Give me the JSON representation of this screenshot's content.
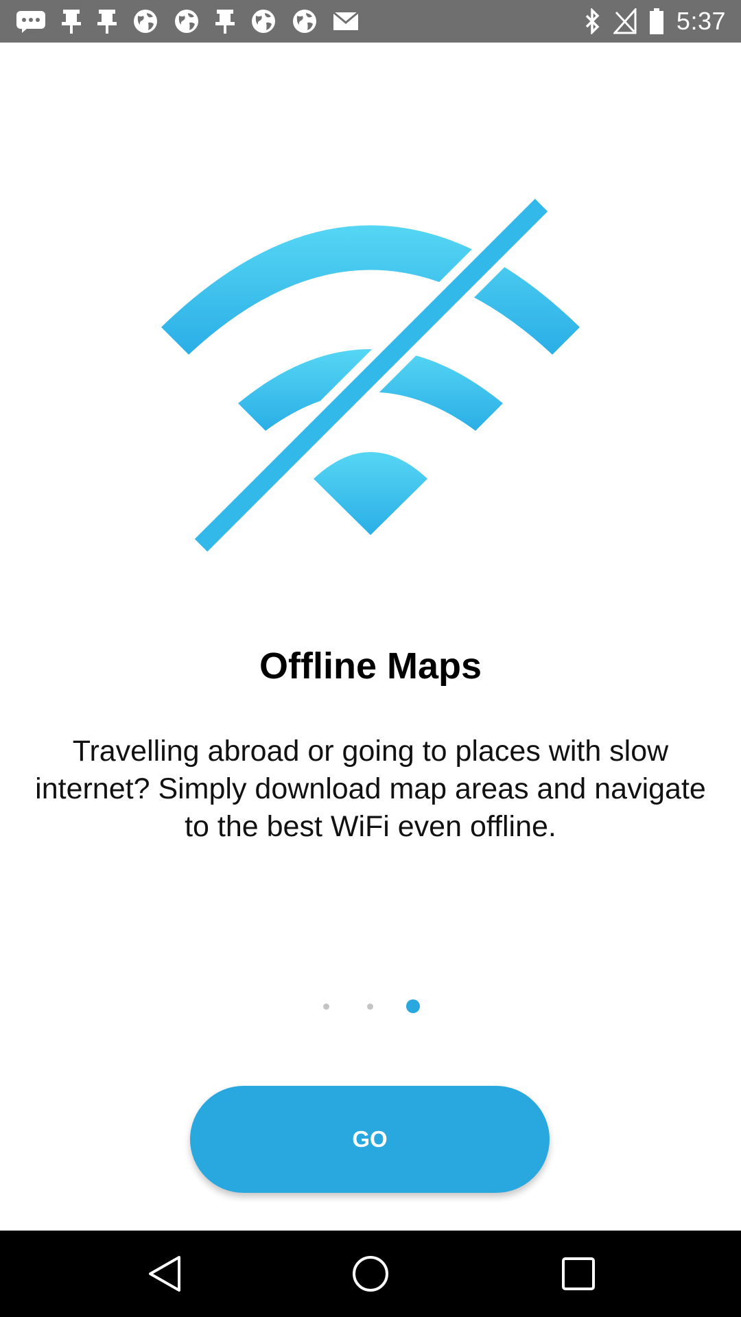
{
  "status_bar": {
    "time": "5:37",
    "notification_icons": [
      "chat-bubble-icon",
      "pin-icon",
      "pin-icon",
      "globe-icon",
      "globe-icon",
      "pin-icon",
      "globe-icon",
      "globe-icon",
      "mail-icon"
    ],
    "system_icons": [
      "bluetooth-icon",
      "signal-muted-icon",
      "battery-icon"
    ]
  },
  "hero": {
    "icon": "wifi-off-icon",
    "color": "#3cc2ec"
  },
  "onboarding": {
    "title": "Offline Maps",
    "description": "Travelling abroad or going to places with slow internet? Simply download map areas and navigate to the best WiFi even offline."
  },
  "pager": {
    "page_count": 3,
    "current_page": 3
  },
  "go_button": {
    "label": "GO",
    "color": "#29a8e0"
  },
  "nav_bar": {
    "buttons": [
      "back-icon",
      "home-icon",
      "recents-icon"
    ]
  }
}
